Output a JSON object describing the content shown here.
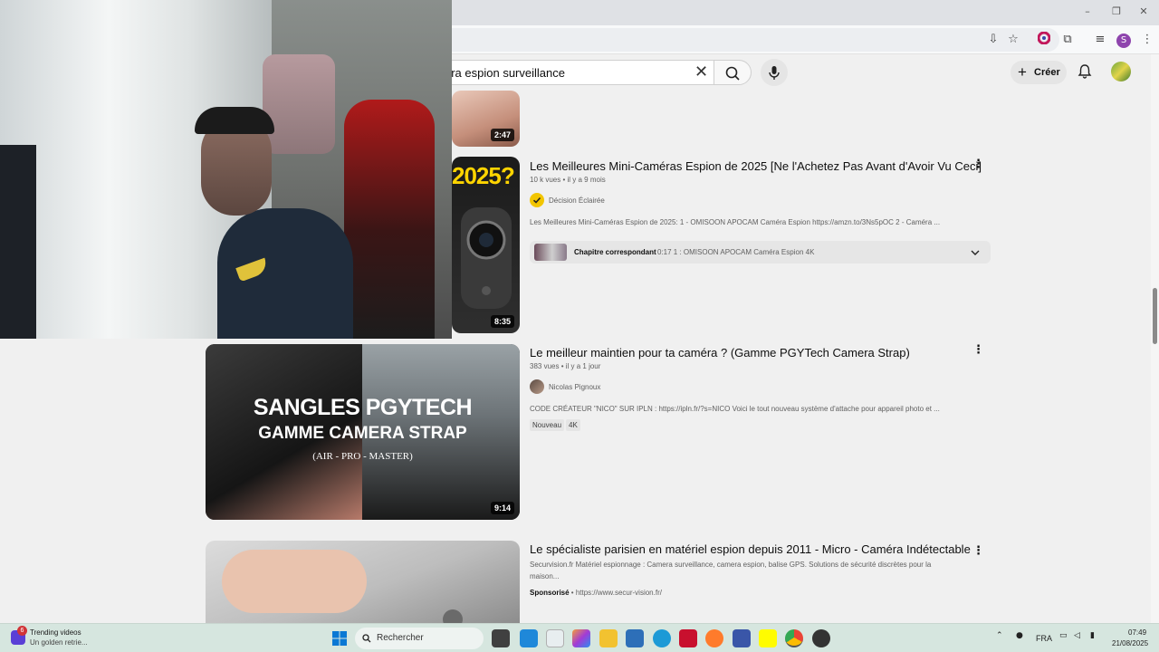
{
  "search": {
    "value": "era espion surveillance"
  },
  "header": {
    "create_label": "Créer"
  },
  "profile": {
    "initial": "S"
  },
  "results": [
    {
      "duration": "2:47"
    },
    {
      "title": "Les Meilleures Mini-Caméras Espion de 2025 [Ne l'Achetez Pas Avant d'Avoir Vu Ceci]",
      "views": "10 k vues",
      "age": "il y a 9 mois",
      "channel": "Décision Éclairée",
      "description": "Les Meilleures Mini-Caméras Espion de 2025: 1 - OMISOON APOCAM Caméra Espion https://amzn.to/3Ns5pOC 2 - Caméra ...",
      "chapter_label": "Chapitre correspondant",
      "chapter_text": "0:17 1 : OMISOON APOCAM Caméra Espion 4K",
      "duration": "8:35",
      "thumb_text": "2025?"
    },
    {
      "title": "Le meilleur maintien pour ta caméra ? (Gamme PGYTech Camera Strap)",
      "views": "383 vues",
      "age": "il y a 1 jour",
      "channel": "Nicolas Pignoux",
      "description": "CODE CRÉATEUR \"NICO\" SUR IPLN : https://ipln.fr/?s=NICO Voici le tout nouveau système d'attache pour appareil photo et ...",
      "badges": [
        "Nouveau",
        "4K"
      ],
      "duration": "9:14",
      "thumb_line1": "SANGLES PGYTECH",
      "thumb_line2": "GAMME CAMERA STRAP",
      "thumb_line3": "(AIR - PRO - MASTER)"
    },
    {
      "title": "Le spécialiste parisien en matériel espion depuis 2011 - Micro - Caméra Indétectable",
      "description_line1": "Securvision.fr Matériel espionnage : Camera surveillance, camera espion, balise GPS. Solutions de sécurité discrètes pour la",
      "description_line2": "maison...",
      "sponsored_label": "Sponsorisé",
      "url": "https://www.secur-vision.fr/"
    }
  ],
  "taskbar": {
    "widget_badge": "6",
    "widget_title": "Trending videos",
    "widget_sub": "Un golden retrie...",
    "search_label": "Rechercher",
    "lang": "FRA",
    "time": "07:49",
    "date": "21/08/2025"
  },
  "colors": {
    "accent": "#f2c500",
    "brand_red": "#ff0000",
    "taskbar": "#d6e6df"
  }
}
